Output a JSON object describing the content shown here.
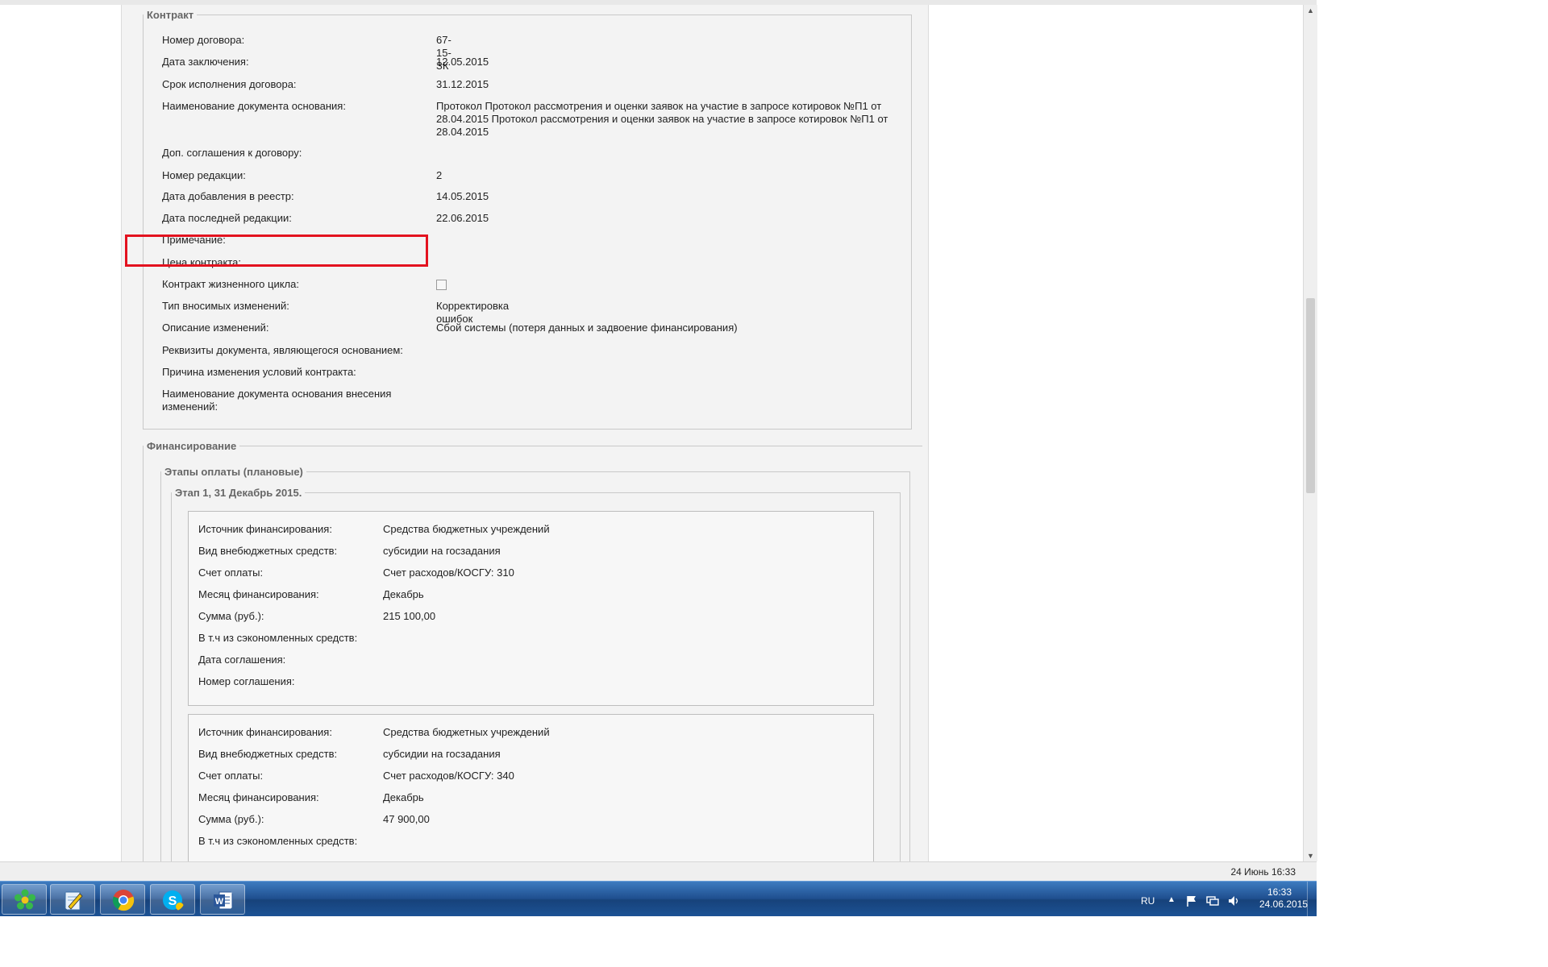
{
  "contract": {
    "legend": "Контракт",
    "fields": [
      {
        "label": "Номер договора:",
        "value": "67-15-ЗК"
      },
      {
        "label": "Дата заключения:",
        "value": "12.05.2015"
      },
      {
        "label": "Срок исполнения договора:",
        "value": "31.12.2015"
      },
      {
        "label": "Наименование документа основания:",
        "value": "Протокол Протокол рассмотрения и оценки заявок на участие в запросе котировок №П1 от 28.04.2015 Протокол рассмотрения и оценки заявок на участие в запросе котировок №П1 от 28.04.2015"
      },
      {
        "label": "Доп. соглашения к договору:",
        "value": ""
      },
      {
        "label": "Номер редакции:",
        "value": "2"
      },
      {
        "label": "Дата добавления в реестр:",
        "value": "14.05.2015"
      },
      {
        "label": "Дата последней редакции:",
        "value": "22.06.2015"
      },
      {
        "label": "Примечание:",
        "value": ""
      },
      {
        "label": "Цена контракта:",
        "value": ""
      },
      {
        "label": "Контракт жизненного цикла:",
        "value": ""
      },
      {
        "label": "Тип вносимых изменений:",
        "value": "Корректировка ошибок"
      },
      {
        "label": "Описание изменений:",
        "value": "Сбой системы (потеря данных и задвоение финансирования)"
      },
      {
        "label": "Реквизиты документа, являющегося основанием:",
        "value": ""
      },
      {
        "label": "Причина изменения условий контракта:",
        "value": ""
      },
      {
        "label": "Наименование документа основания внесения изменений:",
        "value": ""
      }
    ],
    "lifecycle_checked": false
  },
  "financing": {
    "legend": "Финансирование",
    "stages_legend": "Этапы оплаты (плановые)",
    "stage_legend": "Этап 1, 31 Декабрь 2015.",
    "blocks": [
      {
        "fields": [
          {
            "label": "Источник финансирования:",
            "value": "Средства бюджетных учреждений"
          },
          {
            "label": "Вид внебюджетных средств:",
            "value": "субсидии на госзадания"
          },
          {
            "label": "Счет оплаты:",
            "value": "Счет расходов/КОСГУ: 310"
          },
          {
            "label": "Месяц финансирования:",
            "value": "Декабрь"
          },
          {
            "label": "Сумма (руб.):",
            "value": "215 100,00"
          },
          {
            "label": "В т.ч из сэкономленных средств:",
            "value": ""
          },
          {
            "label": "Дата соглашения:",
            "value": ""
          },
          {
            "label": "Номер соглашения:",
            "value": ""
          }
        ]
      },
      {
        "fields": [
          {
            "label": "Источник финансирования:",
            "value": "Средства бюджетных учреждений"
          },
          {
            "label": "Вид внебюджетных средств:",
            "value": "субсидии на госзадания"
          },
          {
            "label": "Счет оплаты:",
            "value": "Счет расходов/КОСГУ: 340"
          },
          {
            "label": "Месяц финансирования:",
            "value": "Декабрь"
          },
          {
            "label": "Сумма (руб.):",
            "value": "47 900,00"
          },
          {
            "label": "В т.ч из сэкономленных средств:",
            "value": ""
          }
        ]
      }
    ]
  },
  "statusbar": {
    "text": "24 Июнь 16:33"
  },
  "taskbar": {
    "apps": [
      {
        "icon": "icq-flower-icon"
      },
      {
        "icon": "notepad-pen-icon"
      },
      {
        "icon": "chrome-icon"
      },
      {
        "icon": "skype-icon"
      },
      {
        "icon": "word-icon"
      }
    ],
    "lang": "RU",
    "time": "16:33",
    "date": "24.06.2015"
  },
  "colors": {
    "highlight": "#e3121f",
    "taskbar": "#1f4f8f",
    "page_bg": "#f3f3f3"
  }
}
